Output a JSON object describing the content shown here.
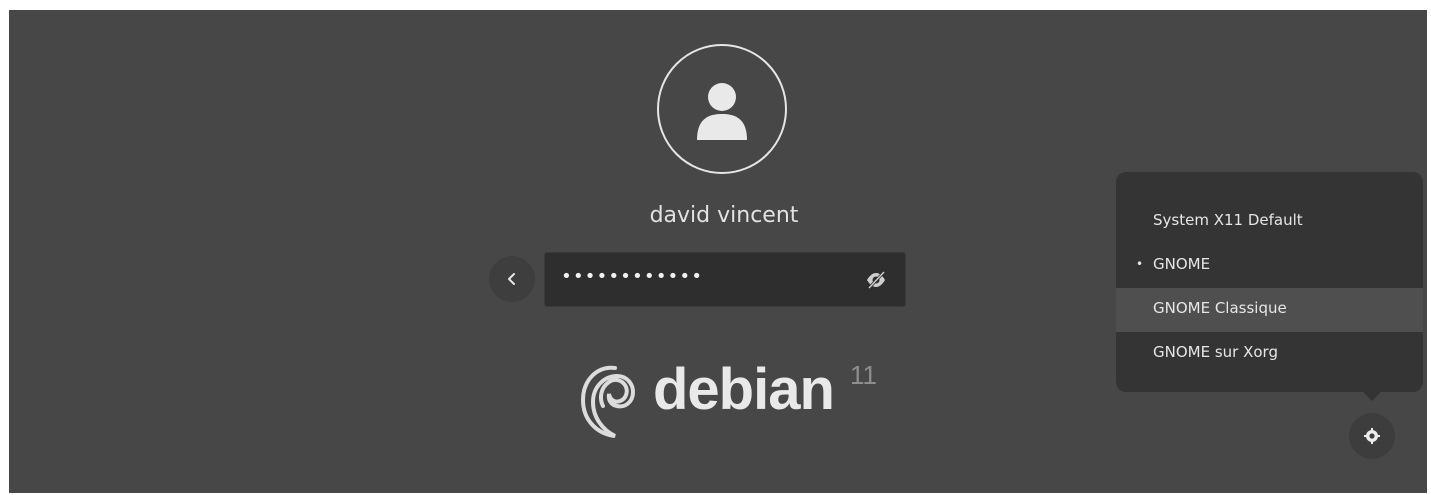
{
  "login": {
    "username": "david vincent",
    "password_value": "••••••••••••"
  },
  "icons": {
    "avatar": "user-avatar-icon",
    "back": "chevron-left-icon",
    "reveal": "eye-slash-icon",
    "session": "gear-icon"
  },
  "branding": {
    "logo_text": "debian",
    "logo_version": "11"
  },
  "session_menu": {
    "items": [
      {
        "label": "System X11 Default",
        "selected": false
      },
      {
        "label": "GNOME",
        "selected": true
      },
      {
        "label": "GNOME Classique",
        "selected": false
      },
      {
        "label": "GNOME sur Xorg",
        "selected": false
      }
    ],
    "selected_marker": "•"
  },
  "colors": {
    "background": "#474747",
    "menu_background": "#343434",
    "menu_hover": "#4f4f4f",
    "field_background": "#2e2e2e",
    "text": "#e6e6e6"
  }
}
